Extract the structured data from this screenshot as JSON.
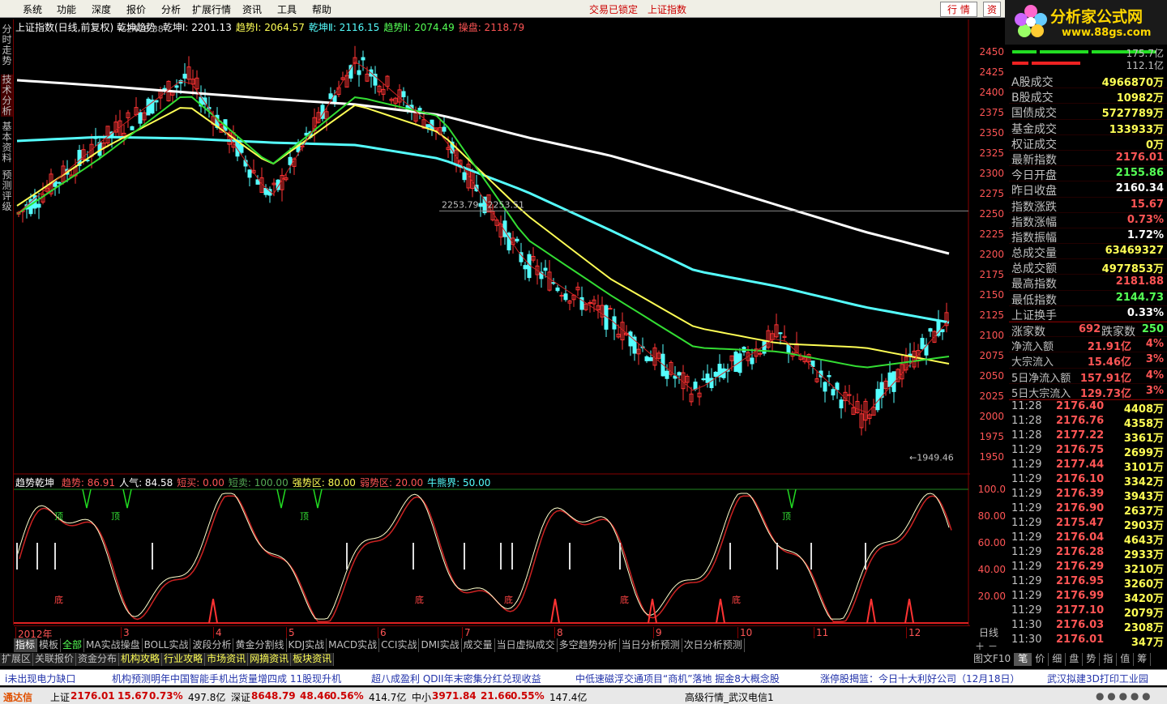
{
  "menu": [
    "系统",
    "功能",
    "深度",
    "报价",
    "分析",
    "扩展行情",
    "资讯",
    "工具",
    "帮助"
  ],
  "menu_center": [
    "交易已锁定",
    "上证指数"
  ],
  "menu_right": [
    "行 情",
    "资"
  ],
  "logo": {
    "title": "分析家公式网",
    "url": "www.88gs.com"
  },
  "vtabs": [
    "分时走势",
    "技术分析",
    "基本资料",
    "预测评级"
  ],
  "chart_header": {
    "name": "上证指数(日线,前复权)",
    "indicator": "乾坤趋势",
    "items": [
      {
        "label": "乾坤Ⅰ:",
        "value": "2201.13",
        "color": "#ffffff"
      },
      {
        "label": "趋势Ⅰ:",
        "value": "2064.57",
        "color": "#ffff55"
      },
      {
        "label": "乾坤Ⅱ:",
        "value": "2116.15",
        "color": "#55ffff"
      },
      {
        "label": "趋势Ⅱ:",
        "value": "2074.49",
        "color": "#55ff55"
      },
      {
        "label": "操盘:",
        "value": "2118.79",
        "color": "#ff5555"
      }
    ]
  },
  "price_axis": [
    "2450",
    "2425",
    "2400",
    "2375",
    "2350",
    "2325",
    "2300",
    "2275",
    "2250",
    "2225",
    "2200",
    "2175",
    "2150",
    "2125",
    "2100",
    "2075",
    "2050",
    "2025",
    "2000",
    "1975",
    "1950"
  ],
  "annotations": {
    "high": "2478.38",
    "low": "1949.46",
    "line": "2253.79 - 2253.51"
  },
  "indicator_header": {
    "name": "趋势乾坤",
    "items": [
      {
        "label": "趋势:",
        "value": "86.91",
        "color": "#ff5555"
      },
      {
        "label": "人气:",
        "value": "84.58",
        "color": "#ffffff"
      },
      {
        "label": "短买:",
        "value": "0.00",
        "color": "#ff5555"
      },
      {
        "label": "短卖:",
        "value": "100.00",
        "color": "#55aa55"
      },
      {
        "label": "强势区:",
        "value": "80.00",
        "color": "#ffff55"
      },
      {
        "label": "弱势区:",
        "value": "20.00",
        "color": "#ff5555"
      },
      {
        "label": "牛熊界:",
        "value": "50.00",
        "color": "#55ffff"
      }
    ]
  },
  "indicator_axis": [
    "100.0",
    "80.00",
    "60.00",
    "40.00",
    "20.00"
  ],
  "indicator_marks": {
    "top": "顶",
    "bottom": "底"
  },
  "date_axis": [
    "2012年",
    "3",
    "4",
    "5",
    "6",
    "7",
    "8",
    "9",
    "10",
    "11",
    "12"
  ],
  "period": "日线",
  "bars": {
    "top": "175.7亿",
    "bottom": "112.1亿"
  },
  "stats": [
    {
      "label": "A股成交",
      "value": "4966870万",
      "color": "#ffff55"
    },
    {
      "label": "B股成交",
      "value": "10982万",
      "color": "#ffff55"
    },
    {
      "label": "国债成交",
      "value": "5727789万",
      "color": "#ffff55"
    },
    {
      "label": "基金成交",
      "value": "133933万",
      "color": "#ffff55"
    },
    {
      "label": "权证成交",
      "value": "0万",
      "color": "#ffff55"
    },
    {
      "label": "最新指数",
      "value": "2176.01",
      "color": "#ff5555"
    },
    {
      "label": "今日开盘",
      "value": "2155.86",
      "color": "#55ff55"
    },
    {
      "label": "昨日收盘",
      "value": "2160.34",
      "color": "#ffffff"
    },
    {
      "label": "指数涨跌",
      "value": "15.67",
      "color": "#ff5555"
    },
    {
      "label": "指数涨幅",
      "value": "0.73%",
      "color": "#ff5555"
    },
    {
      "label": "指数振幅",
      "value": "1.72%",
      "color": "#ffffff"
    },
    {
      "label": "总成交量",
      "value": "63469327",
      "color": "#ffff55"
    },
    {
      "label": "总成交额",
      "value": "4977853万",
      "color": "#ffff55"
    },
    {
      "label": "最高指数",
      "value": "2181.88",
      "color": "#ff5555"
    },
    {
      "label": "最低指数",
      "value": "2144.73",
      "color": "#55ff55"
    },
    {
      "label": "上证换手",
      "value": "0.33%",
      "color": "#ffffff"
    }
  ],
  "updown": {
    "up_label": "涨家数",
    "up": "692",
    "down_label": "跌家数",
    "down": "250"
  },
  "flows": [
    {
      "label": "净流入额",
      "value": "21.91亿",
      "pct": "4%"
    },
    {
      "label": "大宗流入",
      "value": "15.46亿",
      "pct": "3%"
    },
    {
      "label": "5日净流入额",
      "value": "157.91亿",
      "pct": "4%"
    },
    {
      "label": "5日大宗流入",
      "value": "129.73亿",
      "pct": "3%"
    }
  ],
  "ticks": [
    [
      "11:28",
      "2176.40",
      "4408万"
    ],
    [
      "11:28",
      "2176.76",
      "4358万"
    ],
    [
      "11:28",
      "2177.22",
      "3361万"
    ],
    [
      "11:29",
      "2176.75",
      "2699万"
    ],
    [
      "11:29",
      "2177.44",
      "3101万"
    ],
    [
      "11:29",
      "2176.10",
      "3342万"
    ],
    [
      "11:29",
      "2176.39",
      "3943万"
    ],
    [
      "11:29",
      "2176.90",
      "2637万"
    ],
    [
      "11:29",
      "2175.47",
      "2903万"
    ],
    [
      "11:29",
      "2176.04",
      "4643万"
    ],
    [
      "11:29",
      "2176.28",
      "2933万"
    ],
    [
      "11:29",
      "2176.29",
      "3210万"
    ],
    [
      "11:29",
      "2176.95",
      "3260万"
    ],
    [
      "11:29",
      "2176.99",
      "3420万"
    ],
    [
      "11:29",
      "2177.10",
      "2079万"
    ],
    [
      "11:30",
      "2176.03",
      "2308万"
    ],
    [
      "11:30",
      "2176.01",
      "347万"
    ]
  ],
  "tabs1": [
    "指标",
    "模板",
    "全部",
    "MA实战操盘",
    "BOLL实战",
    "波段分析",
    "黄金分割线",
    "KDJ实战",
    "MACD实战",
    "CCI实战",
    "DMI实战",
    "成交量",
    "当日虚拟成交",
    "多空趋势分析",
    "当日分析预测",
    "次日分析预测"
  ],
  "tabs2": [
    "扩展区",
    "关联报价",
    "资金分布",
    "机构攻略",
    "行业攻略",
    "市场资讯",
    "网摘资讯",
    "板块资讯"
  ],
  "tabs_right": [
    "图文F10",
    "笔",
    "价",
    "细",
    "盘",
    "势",
    "指",
    "值",
    "筹"
  ],
  "news": [
    "i未出现电力缺口",
    "机构预测明年中国智能手机出货量增四成 11股现升机",
    "超八成盈利 QDII年末密集分红兑现收益",
    "中低速磁浮交通项目“商机”落地 掘金8大概念股",
    "涨停股揭篮：今日十大利好公司（12月18日）",
    "武汉拟建3D打印工业园"
  ],
  "status": {
    "brand": "通达信",
    "sh_label": "上证",
    "sh": "2176.01",
    "sh_chg": "15.67",
    "sh_pct": "0.73%",
    "sh_amt": "497.8亿",
    "sz_label": "深证",
    "sz": "8648.79",
    "sz_chg": "48.46",
    "sz_pct": "0.56%",
    "sz_amt": "414.7亿",
    "zx_label": "中小",
    "zx": "3971.84",
    "zx_chg": "21.66",
    "zx_pct": "0.55%",
    "zx_amt": "147.4亿",
    "server": "高级行情_武汉电信1"
  },
  "chart_data": {
    "type": "line",
    "ylim": [
      1930,
      2490
    ],
    "x": [
      "2012-01",
      "2012-02",
      "2012-03",
      "2012-04",
      "2012-05",
      "2012-06",
      "2012-07",
      "2012-08",
      "2012-09",
      "2012-10",
      "2012-11",
      "2012-12"
    ],
    "series": [
      {
        "name": "乾坤Ⅰ",
        "values": [
          2415,
          2408,
          2400,
          2392,
          2385,
          2372,
          2345,
          2322,
          2292,
          2260,
          2228,
          2201
        ]
      },
      {
        "name": "乾坤Ⅱ",
        "values": [
          2340,
          2345,
          2343,
          2338,
          2335,
          2318,
          2278,
          2230,
          2180,
          2160,
          2135,
          2116
        ]
      },
      {
        "name": "趋势Ⅰ",
        "values": [
          2260,
          2330,
          2385,
          2310,
          2385,
          2350,
          2250,
          2170,
          2110,
          2090,
          2085,
          2065
        ]
      },
      {
        "name": "趋势Ⅱ",
        "values": [
          2250,
          2320,
          2400,
          2310,
          2395,
          2370,
          2220,
          2150,
          2085,
          2080,
          2060,
          2074
        ]
      },
      {
        "name": "操盘",
        "values": [
          2250,
          2340,
          2420,
          2270,
          2440,
          2350,
          2190,
          2120,
          2030,
          2100,
          2000,
          2119
        ]
      }
    ],
    "annotations": {
      "high": 2478.38,
      "low": 1949.46
    }
  }
}
